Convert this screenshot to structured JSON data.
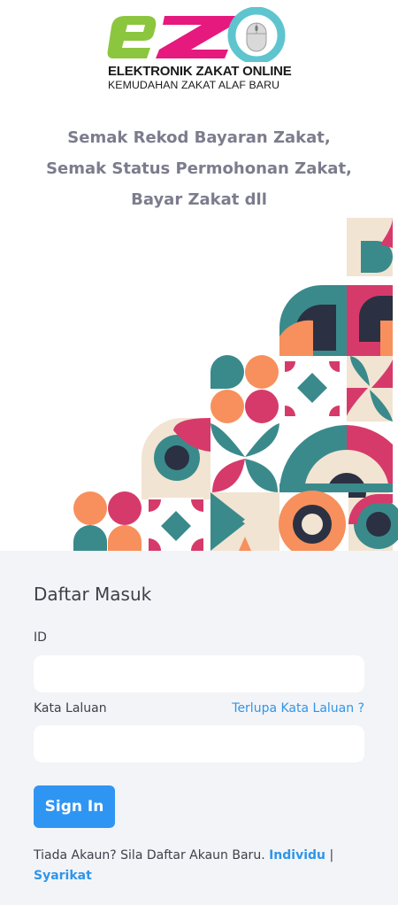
{
  "logo": {
    "mark_text": "eZ",
    "line1": "ELEKTRONIK ZAKAT ONLINE",
    "line2": "KEMUDAHAN ZAKAT ALAF BARU"
  },
  "tagline": [
    "Semak Rekod Bayaran Zakat,",
    "Semak Status Permohonan Zakat,",
    "Bayar Zakat dll"
  ],
  "login": {
    "title": "Daftar Masuk",
    "id_label": "ID",
    "id_value": "",
    "password_label": "Kata Laluan",
    "password_value": "",
    "forgot_label": "Terlupa Kata Laluan ?",
    "signin_label": "Sign In",
    "signup_text": "Tiada Akaun? Sila Daftar Akaun Baru.",
    "signup_individu": "Individu",
    "signup_separator": "|",
    "signup_syarikat": "Syarikat"
  },
  "colors": {
    "accent_blue": "#2f95f3",
    "teal": "#3a8a8c",
    "pink": "#d63a6a",
    "orange": "#f7905c",
    "navy": "#2b3142",
    "cream": "#f2e4d2",
    "logo_green": "#8cc63f",
    "logo_magenta": "#e6197e",
    "logo_cyan": "#5ec5cf"
  },
  "icons": [
    "mouse-icon",
    "geometric-pattern-illustration"
  ]
}
